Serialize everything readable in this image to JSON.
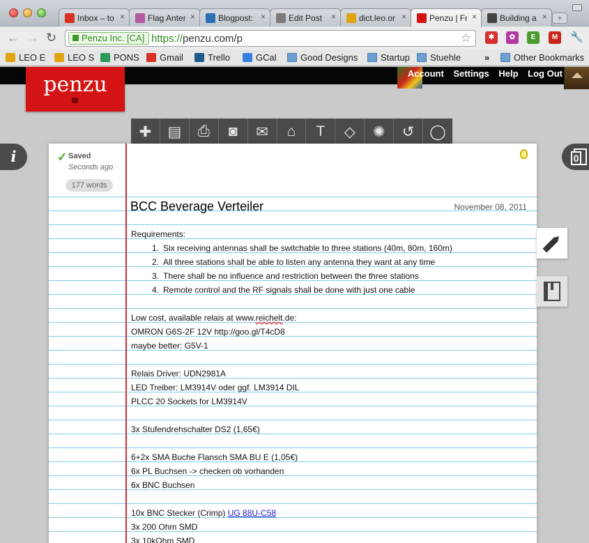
{
  "browser": {
    "tabs": [
      {
        "label": "Inbox – to",
        "favicon_color": "#d93025",
        "active": false
      },
      {
        "label": "Flag Anten",
        "favicon_color": "#b35aa1",
        "active": false
      },
      {
        "label": "Blogpost:",
        "favicon_color": "#2a6fb5",
        "active": false
      },
      {
        "label": "Edit Post",
        "favicon_color": "#7c7c7c",
        "active": false
      },
      {
        "label": "dict.leo.or",
        "favicon_color": "#e0a412",
        "active": false
      },
      {
        "label": "Penzu | Fr",
        "favicon_color": "#d41414",
        "active": true
      },
      {
        "label": "Building a",
        "favicon_color": "#444444",
        "active": false
      }
    ],
    "tab_close_glyph": "×",
    "new_tab_glyph": "+",
    "back_glyph": "←",
    "forward_glyph": "→",
    "reload_glyph": "↻",
    "ev_cert": "Penzu Inc. [CA]",
    "url_scheme": "https://",
    "url_rest": "penzu.com/p",
    "star_glyph": "☆",
    "wrench_glyph": "🔧",
    "extensions": [
      {
        "icon": "lastpass-icon",
        "color": "#d32f2f",
        "glyph": "✱"
      },
      {
        "icon": "settings-extension-icon",
        "color": "#b33aa0",
        "glyph": "✿"
      },
      {
        "icon": "evernote-icon",
        "color": "#4b9a2f",
        "glyph": "E"
      },
      {
        "icon": "gmaps-icon",
        "color": "#c9261a",
        "glyph": "M"
      }
    ]
  },
  "bookmarks": [
    {
      "label": "LEO E",
      "icon": "leo-icon",
      "color": "#e0a412"
    },
    {
      "label": "LEO S",
      "icon": "leo-icon",
      "color": "#e0a412"
    },
    {
      "label": "PONS",
      "icon": "pons-icon",
      "color": "#2c9a5a"
    },
    {
      "label": "Gmail",
      "icon": "gmail-icon",
      "color": "#d93025"
    },
    {
      "label": "Trello",
      "icon": "trello-icon",
      "color": "#1e5a8a"
    },
    {
      "label": "GCal",
      "icon": "gcal-icon",
      "color": "#3a7ee0"
    },
    {
      "label": "Good Designs",
      "icon": "folder-icon",
      "color": "#6e9fd3"
    },
    {
      "label": "Startup",
      "icon": "folder-icon",
      "color": "#6e9fd3"
    },
    {
      "label": "Stuehle",
      "icon": "folder-icon",
      "color": "#6e9fd3"
    }
  ],
  "bookmarks_overflow": "»",
  "bookmarks_other": "Other Bookmarks",
  "penzu": {
    "logo_text": "penzu",
    "menu": [
      "Account",
      "Settings",
      "Help",
      "Log Out"
    ],
    "toolbar": [
      {
        "icon": "new-entry-icon",
        "glyph": "✚"
      },
      {
        "icon": "save-icon",
        "glyph": "▤"
      },
      {
        "icon": "print-icon",
        "glyph": "⎙"
      },
      {
        "icon": "photo-icon",
        "glyph": "◙"
      },
      {
        "icon": "email-icon",
        "glyph": "✉"
      },
      {
        "icon": "lock-icon",
        "glyph": "⌂"
      },
      {
        "icon": "font-icon",
        "glyph": "T"
      },
      {
        "icon": "tag-icon",
        "glyph": "◇"
      },
      {
        "icon": "theme-icon",
        "glyph": "✺"
      },
      {
        "icon": "history-icon",
        "glyph": "↺"
      },
      {
        "icon": "comment-icon",
        "glyph": "◯"
      }
    ],
    "info_glyph": "i",
    "entries_count": "0",
    "saved_label": "Saved",
    "saved_time": "Seconds ago",
    "word_count": "177 words",
    "edit_glyph": "✎",
    "journal_glyph": "▥",
    "entry": {
      "title": "BCC Beverage Verteiler",
      "date": "November 08, 2011",
      "lines": [
        {
          "text": "Requirements:"
        },
        {
          "num": "1.",
          "text": "Six receiving antennas shall be switchable to three stations (40m, 80m, 160m)"
        },
        {
          "num": "2.",
          "text": "All three stations shall be able to listen any antenna they want at any time"
        },
        {
          "num": "3.",
          "text": "There shall be no influence and restriction between the three stations"
        },
        {
          "num": "4.",
          "text": "Remote control and the RF signals shall be done with just one cable"
        },
        {
          "text": ""
        },
        {
          "text": "Low cost, available relais at www.reichelt.de:"
        },
        {
          "text": "OMRON G6S-2F 12V http://goo.gl/T4cD8"
        },
        {
          "text": "maybe better: G5V-1"
        },
        {
          "text": ""
        },
        {
          "text": "Relais Driver: UDN2981A"
        },
        {
          "text": "LED Treiber: LM3914V oder ggf. LM3914 DIL"
        },
        {
          "text": "PLCC 20 Sockets for LM3914V"
        },
        {
          "text": ""
        },
        {
          "text": "3x Stufendrehschalter DS2 (1,65€)"
        },
        {
          "text": ""
        },
        {
          "text": "6+2x SMA Buche Flansch SMA BU E (1,05€)"
        },
        {
          "text": "6x PL Buchsen -> checken ob vorhanden"
        },
        {
          "text": "6x BNC Buchsen"
        },
        {
          "text": ""
        },
        {
          "text": "10x BNC Stecker (Crimp) ",
          "link": "UG 88U-C58"
        },
        {
          "text": "3x 200 Ohm SMD"
        },
        {
          "text": "3x 10kOhm SMD"
        }
      ]
    }
  }
}
